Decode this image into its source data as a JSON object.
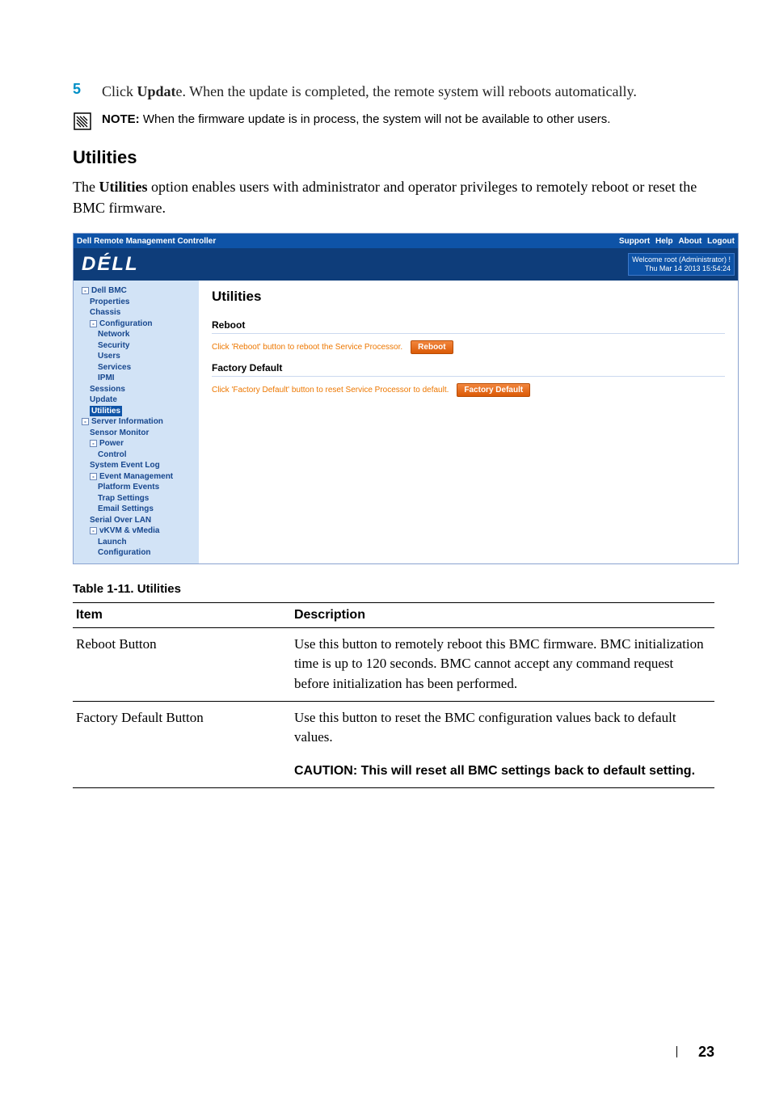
{
  "step": {
    "num": "5",
    "text_a": "Click ",
    "text_bold": "Updat",
    "text_b": "e. When the update is completed, the remote system will reboots automatically."
  },
  "note": {
    "label": "NOTE:",
    "body": " When the firmware update is in process, the system will not be available to other users."
  },
  "section": {
    "heading": "Utilities",
    "para_a": "The ",
    "para_bold": "Utilities",
    "para_b": " option enables users with administrator and operator privileges to remotely reboot or reset the BMC firmware."
  },
  "screenshot": {
    "topbar_title": "Dell Remote Management Controller",
    "top_links": [
      "Support",
      "Help",
      "About",
      "Logout"
    ],
    "brand": "DÉLL",
    "welcome_line1": "Welcome root (Administrator) !",
    "welcome_line2": "Thu Mar 14 2013 15:54:24",
    "nav": {
      "root": "Dell BMC",
      "properties": "Properties",
      "chassis": "Chassis",
      "configuration": "Configuration",
      "network": "Network",
      "security": "Security",
      "users": "Users",
      "services": "Services",
      "ipmi": "IPMI",
      "sessions": "Sessions",
      "update": "Update",
      "utilities": "Utilities",
      "server_info": "Server Information",
      "sensor_monitor": "Sensor Monitor",
      "power": "Power",
      "control": "Control",
      "sys_event_log": "System Event Log",
      "event_mgmt": "Event Management",
      "platform_events": "Platform Events",
      "trap_settings": "Trap Settings",
      "email_settings": "Email Settings",
      "serial_over_lan": "Serial Over LAN",
      "vkvm": "vKVM & vMedia",
      "launch": "Launch",
      "nav_config": "Configuration"
    },
    "main": {
      "title": "Utilities",
      "reboot_heading": "Reboot",
      "reboot_text": "Click 'Reboot' button to reboot the Service Processor.",
      "reboot_btn": "Reboot",
      "fd_heading": "Factory Default",
      "fd_text": "Click 'Factory Default' button to reset Service Processor to default.",
      "fd_btn": "Factory Default"
    }
  },
  "table": {
    "caption": "Table 1-11.    Utilities",
    "headers": [
      "Item",
      "Description"
    ],
    "rows": [
      {
        "item": "Reboot Button",
        "desc": "Use this button to remotely reboot this BMC firmware. BMC initialization time is up to 120 seconds. BMC cannot accept any command request before initialization has been performed."
      },
      {
        "item": "Factory Default Button",
        "desc": "Use this button to reset the BMC configuration values back to default values."
      }
    ],
    "caution": "CAUTION: This will reset all BMC settings back to default setting."
  },
  "page_number": "23"
}
